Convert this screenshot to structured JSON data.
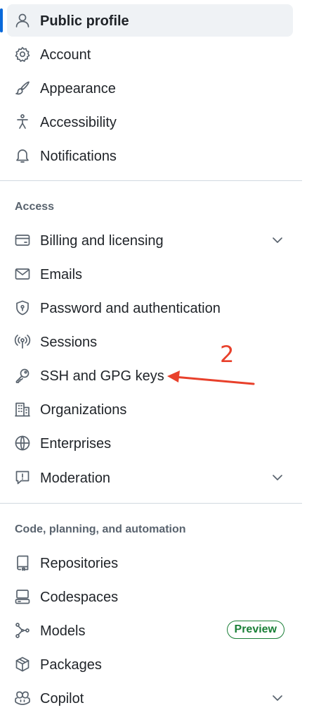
{
  "nav": {
    "items_top": [
      {
        "label": "Public profile",
        "icon": "person-icon",
        "active": true
      },
      {
        "label": "Account",
        "icon": "gear-icon"
      },
      {
        "label": "Appearance",
        "icon": "paintbrush-icon"
      },
      {
        "label": "Accessibility",
        "icon": "accessibility-icon"
      },
      {
        "label": "Notifications",
        "icon": "bell-icon"
      }
    ],
    "access_heading": "Access",
    "access_items": [
      {
        "label": "Billing and licensing",
        "icon": "credit-card-icon",
        "expandable": true
      },
      {
        "label": "Emails",
        "icon": "mail-icon"
      },
      {
        "label": "Password and authentication",
        "icon": "shield-lock-icon"
      },
      {
        "label": "Sessions",
        "icon": "broadcast-icon"
      },
      {
        "label": "SSH and GPG keys",
        "icon": "key-icon"
      },
      {
        "label": "Organizations",
        "icon": "organization-icon"
      },
      {
        "label": "Enterprises",
        "icon": "globe-icon"
      },
      {
        "label": "Moderation",
        "icon": "report-icon",
        "expandable": true
      }
    ],
    "code_heading": "Code, planning, and automation",
    "code_items": [
      {
        "label": "Repositories",
        "icon": "repo-icon"
      },
      {
        "label": "Codespaces",
        "icon": "codespaces-icon"
      },
      {
        "label": "Models",
        "icon": "models-icon",
        "badge": "Preview"
      },
      {
        "label": "Packages",
        "icon": "package-icon"
      },
      {
        "label": "Copilot",
        "icon": "copilot-icon",
        "expandable": true
      }
    ]
  },
  "annotation": {
    "number": "2",
    "color": "#e8402b"
  },
  "colors": {
    "active_indicator": "#0969da",
    "badge": "#1a7f37",
    "divider": "#d1d9e0"
  }
}
